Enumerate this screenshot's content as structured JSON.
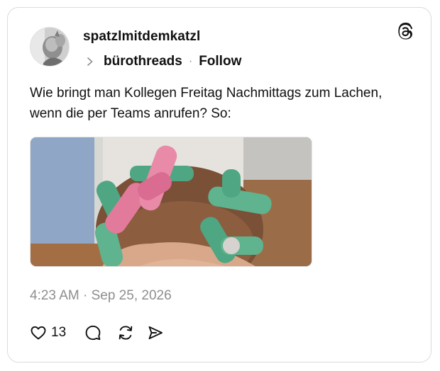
{
  "post": {
    "author": {
      "username": "spatzlmitdemkatzl",
      "avatar_icon": "profile-photo"
    },
    "community": {
      "name": "bürothreads",
      "separator": "·",
      "follow_label": "Follow"
    },
    "text": "Wie bringt man Kollegen Freitag Nachmittags zum Lachen, wenn die per Teams anrufen? So:",
    "image": {
      "description_icon": "photo-hair-curlers"
    },
    "timestamp": "4:23 AM · Sep 25, 2026",
    "actions": {
      "like_icon": "heart-icon",
      "like_count": "13",
      "reply_icon": "comment-icon",
      "repost_icon": "repost-icon",
      "share_icon": "share-icon"
    }
  },
  "brand": {
    "logo_icon": "threads-logo",
    "text_color": "#101010",
    "muted_color": "#8e8e8e",
    "border_color": "#dbdbdb"
  }
}
